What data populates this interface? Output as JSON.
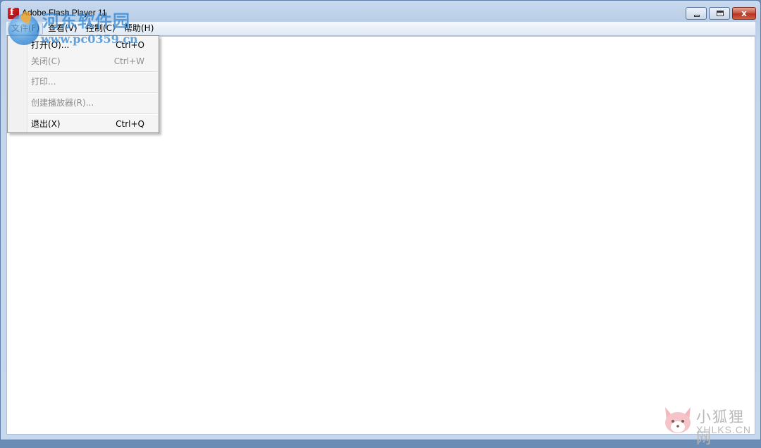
{
  "window": {
    "title": "Adobe Flash Player 11",
    "close_glyph": "x"
  },
  "menubar": {
    "items": [
      {
        "label": "文件(F)"
      },
      {
        "label": "查看(V)"
      },
      {
        "label": "控制(C)"
      },
      {
        "label": "帮助(H)"
      }
    ]
  },
  "file_menu": {
    "items": [
      {
        "label": "打开(O)...",
        "accelerator": "Ctrl+O",
        "enabled": true
      },
      {
        "label": "关闭(C)",
        "accelerator": "Ctrl+W",
        "enabled": false
      },
      {
        "label": "打印...",
        "accelerator": "",
        "enabled": false
      },
      {
        "label": "创建播放器(R)...",
        "accelerator": "",
        "enabled": false
      },
      {
        "label": "退出(X)",
        "accelerator": "Ctrl+Q",
        "enabled": true
      }
    ]
  },
  "watermarks": {
    "top_left": {
      "title": "河东软件园",
      "url": "www.pc0359.cn"
    },
    "bottom_right": {
      "title": "小狐狸网",
      "url": "XHLKS.CN"
    }
  },
  "colors": {
    "title_accent": "#e4252a",
    "close_button": "#c85a45"
  }
}
